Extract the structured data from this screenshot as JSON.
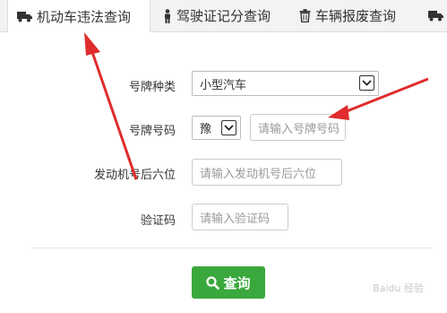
{
  "tabs": [
    {
      "label": "机动车违法查询",
      "icon": "truck-icon"
    },
    {
      "label": "驾驶证记分查询",
      "icon": "person-icon"
    },
    {
      "label": "车辆报废查询",
      "icon": "trash-icon"
    },
    {
      "label": "",
      "icon": "truck-icon"
    }
  ],
  "form": {
    "plate_type_label": "号牌种类",
    "plate_type_value": "小型汽车",
    "plate_number_label": "号牌号码",
    "plate_prefix_value": "豫",
    "plate_number_placeholder": "请输入号牌号码",
    "engine_label": "发动机号后六位",
    "engine_placeholder": "请输入发动机号后六位",
    "captcha_label": "验证码",
    "captcha_placeholder": "请输入验证码",
    "submit_label": "查询"
  },
  "watermark": "Baidu 经验",
  "colors": {
    "accent_green": "#3aa83c",
    "annotation_red": "#e02c2c"
  }
}
